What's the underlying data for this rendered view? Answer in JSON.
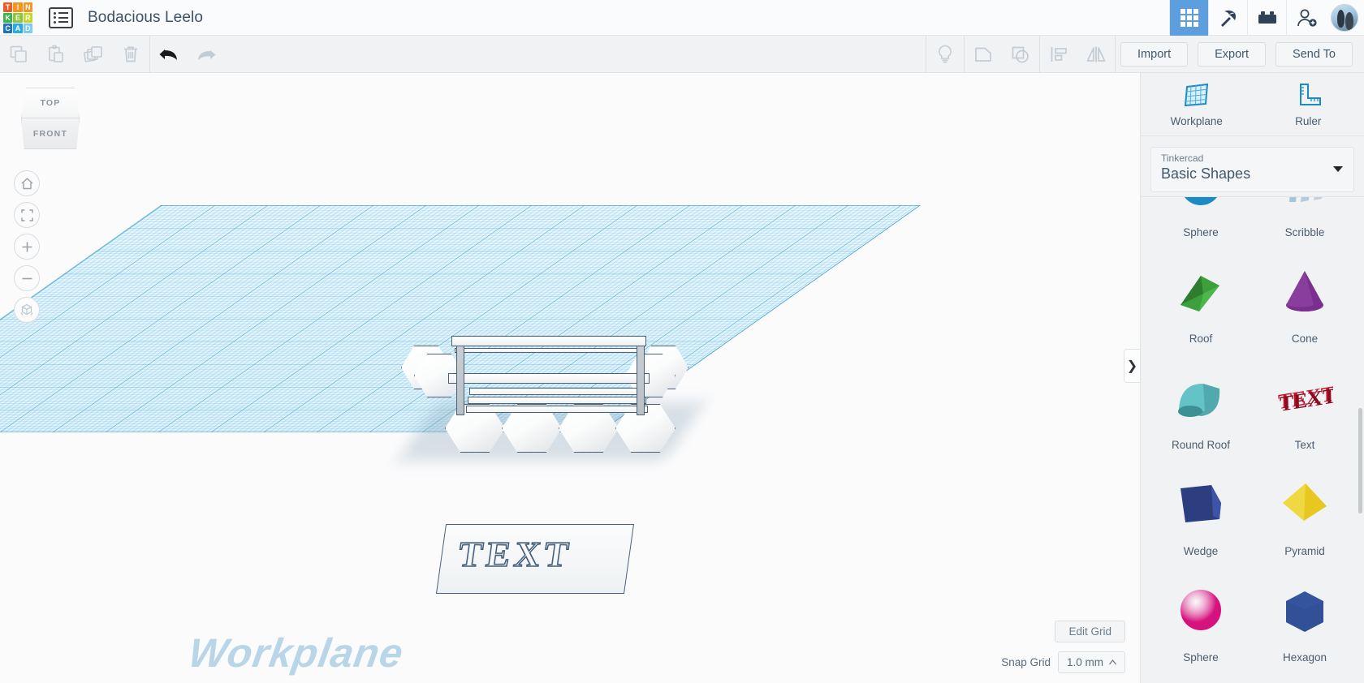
{
  "app": {
    "logo_name": "tinkercad-logo",
    "logo_tiles": [
      {
        "letter": "T",
        "color": "#f05a28"
      },
      {
        "letter": "I",
        "color": "#f7941e"
      },
      {
        "letter": "N",
        "color": "#f7941e"
      },
      {
        "letter": "K",
        "color": "#39b54a"
      },
      {
        "letter": "E",
        "color": "#8cc63f"
      },
      {
        "letter": "R",
        "color": "#c3d82e"
      },
      {
        "letter": "C",
        "color": "#1b75bc"
      },
      {
        "letter": "A",
        "color": "#29abe2"
      },
      {
        "letter": "D",
        "color": "#7accf0"
      }
    ],
    "design_title": "Bodacious Leelo",
    "accent_blue": "#5c9ede",
    "text_blue": "#3b5168"
  },
  "topbar": {
    "apps_label": "Apps",
    "minecraft_label": "Minecraft",
    "blocks_label": "Blocks",
    "invite_label": "Invite",
    "avatar_label": "Account"
  },
  "toolbar": {
    "copy_label": "Copy",
    "paste_label": "Paste",
    "duplicate_label": "Duplicate",
    "delete_label": "Delete",
    "undo_label": "Undo",
    "redo_label": "Redo",
    "notes_label": "Notes",
    "group_label": "Group",
    "ungroup_label": "Ungroup",
    "align_label": "Align",
    "mirror_label": "Mirror",
    "import_label": "Import",
    "export_label": "Export",
    "sendto_label": "Send To"
  },
  "canvas": {
    "viewcube_top": "TOP",
    "viewcube_front": "FRONT",
    "home_label": "Home View",
    "fit_label": "Fit to View",
    "zoom_in_label": "Zoom In",
    "zoom_out_label": "Zoom Out",
    "perspective_label": "Switch to Orthographic",
    "workplane_watermark": "Workplane",
    "plate_text": "TEXT",
    "edit_grid_label": "Edit Grid",
    "snap_grid_label": "Snap Grid",
    "snap_grid_value": "1.0 mm",
    "collapse_label": "❯"
  },
  "panel": {
    "workplane_label": "Workplane",
    "ruler_label": "Ruler",
    "library_owner": "Tinkercad",
    "library_name": "Basic Shapes",
    "shapes": [
      {
        "label": "Sphere",
        "icon": "sphere-shape",
        "color": "#1b8bc4"
      },
      {
        "label": "Scribble",
        "icon": "scribble-shape",
        "color": "#a8c4d8"
      },
      {
        "label": "Roof",
        "icon": "roof-shape",
        "color": "#3da03d"
      },
      {
        "label": "Cone",
        "icon": "cone-shape",
        "color": "#7b2f8f"
      },
      {
        "label": "Round Roof",
        "icon": "round-roof-shape",
        "color": "#4fa9ad"
      },
      {
        "label": "Text",
        "icon": "text-shape",
        "color": "#c8102e"
      },
      {
        "label": "Wedge",
        "icon": "wedge-shape",
        "color": "#2c3d80"
      },
      {
        "label": "Pyramid",
        "icon": "pyramid-shape",
        "color": "#e8c820"
      },
      {
        "label": "Sphere",
        "icon": "sphere-pink-shape",
        "color": "#d6127e"
      },
      {
        "label": "Hexagon",
        "icon": "hexagon-shape",
        "color": "#34559e"
      }
    ]
  }
}
